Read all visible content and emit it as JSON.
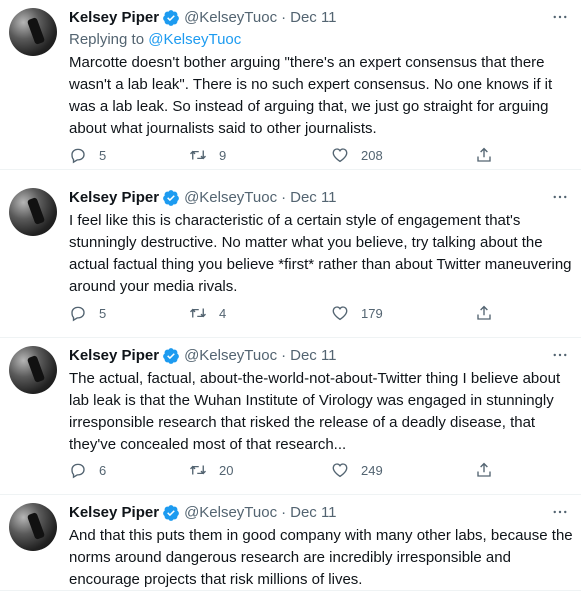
{
  "tweets": [
    {
      "name": "Kelsey Piper",
      "handle": "@KelseyTuoc",
      "separator": "·",
      "date": "Dec 11",
      "replying_prefix": "Replying to",
      "replying_to": "@KelseyTuoc",
      "text": "Marcotte doesn't bother arguing \"there's an expert consensus that there wasn't a lab leak\". There is no such expert consensus. No one knows if it was a lab leak. So instead of arguing that, we just go straight for arguing about what journalists said to other journalists.",
      "replies": "5",
      "retweets": "9",
      "likes": "208"
    },
    {
      "name": "Kelsey Piper",
      "handle": "@KelseyTuoc",
      "separator": "·",
      "date": "Dec 11",
      "text": "I feel like this is characteristic of a certain style of engagement that's stunningly destructive. No matter what you believe, try talking about the actual factual thing you believe *first* rather than about Twitter maneuvering around your media rivals.",
      "replies": "5",
      "retweets": "4",
      "likes": "179"
    },
    {
      "name": "Kelsey Piper",
      "handle": "@KelseyTuoc",
      "separator": "·",
      "date": "Dec 11",
      "text": "The actual, factual, about-the-world-not-about-Twitter thing I believe about lab leak is that the Wuhan Institute of Virology was engaged in stunningly irresponsible research that risked the release of a deadly disease, that they've concealed most of that research...",
      "replies": "6",
      "retweets": "20",
      "likes": "249"
    },
    {
      "name": "Kelsey Piper",
      "handle": "@KelseyTuoc",
      "separator": "·",
      "date": "Dec 11",
      "text": "And that this puts them in good company with many other labs, because the norms around dangerous research are incredibly irresponsible and encourage projects that risk millions of lives."
    }
  ],
  "icons": {
    "verified": "verified-badge-icon",
    "more": "more-icon",
    "reply": "reply-icon",
    "retweet": "retweet-icon",
    "like": "heart-icon",
    "share": "share-icon"
  },
  "colors": {
    "accent": "#1d9bf0",
    "secondary_text": "#536471",
    "primary_text": "#0f1419",
    "divider": "#eff3f4"
  }
}
